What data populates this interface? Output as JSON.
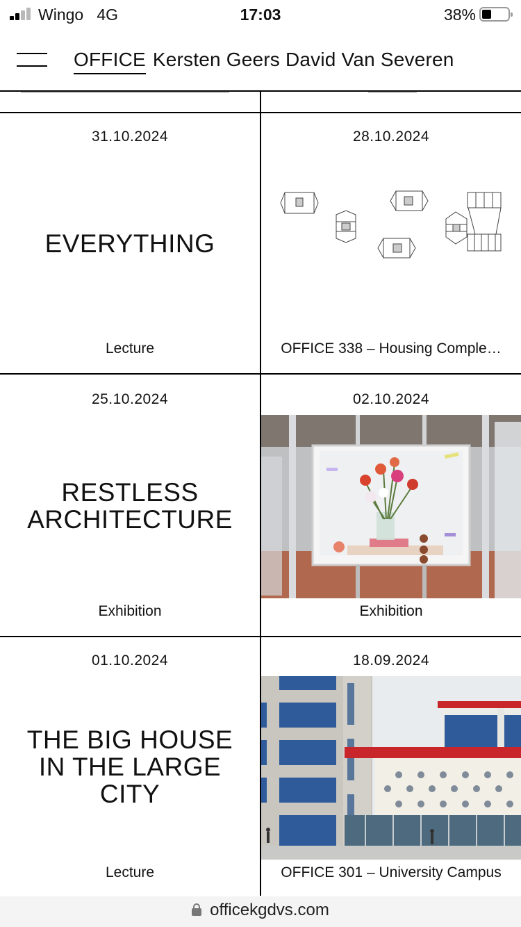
{
  "status_bar": {
    "carrier": "Wingo",
    "network": "4G",
    "time": "17:03",
    "battery": "38%",
    "battery_level": 0.38
  },
  "header": {
    "brand": "OFFICE",
    "subtitle": "Kersten Geers David Van Severen"
  },
  "items": [
    {
      "date": "31.10.2024",
      "title_lines": [
        "EVERYTHING"
      ],
      "tag": "Lecture"
    },
    {
      "date": "28.10.2024",
      "image": "floor-plans-image",
      "tag": "OFFICE 338 – Housing Comple…"
    },
    {
      "date": "25.10.2024",
      "title_lines": [
        "RESTLESS",
        "ARCHITECTURE"
      ],
      "tag": "Exhibition"
    },
    {
      "date": "02.10.2024",
      "image": "flower-photo-exhibition-image",
      "tag": "Exhibition"
    },
    {
      "date": "01.10.2024",
      "title_lines": [
        "THE BIG HOUSE",
        "IN THE LARGE",
        "CITY"
      ],
      "tag": "Lecture"
    },
    {
      "date": "18.09.2024",
      "image": "university-campus-building-image",
      "tag": "OFFICE 301 – University Campus"
    }
  ],
  "url_bar": {
    "domain": "officekgdvs.com"
  },
  "colors": {
    "accent_red": "#c8262a",
    "glass_blue": "#2f5b9a",
    "floor_brick": "#b0694f"
  }
}
